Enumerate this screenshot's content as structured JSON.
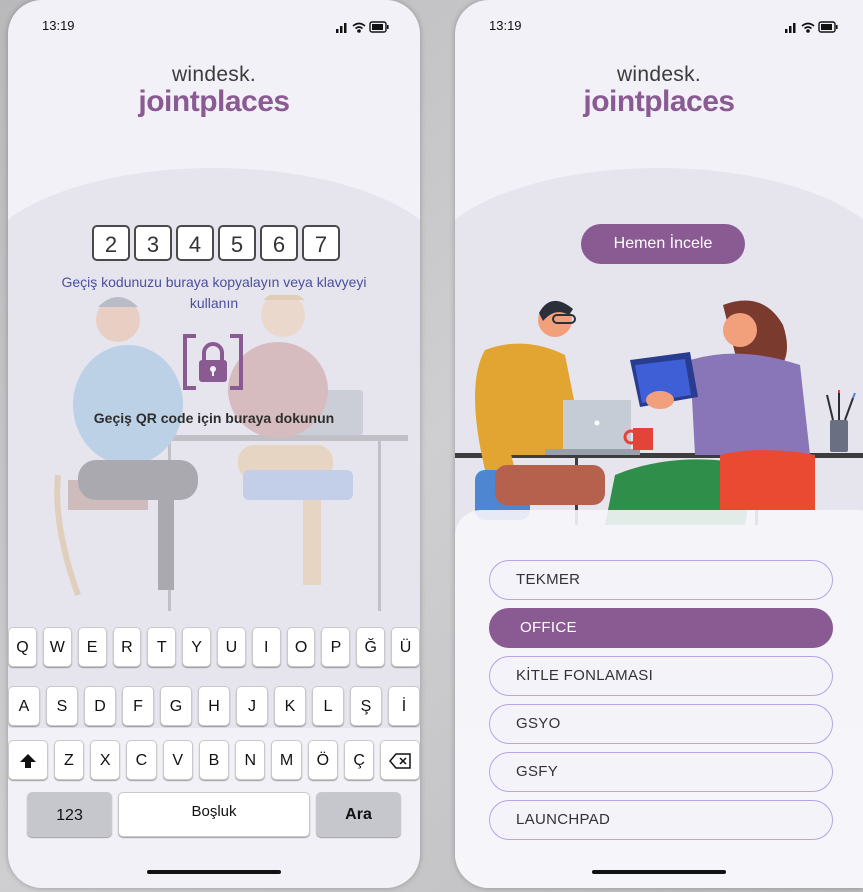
{
  "left": {
    "status": {
      "time": "13:19"
    },
    "logo": {
      "top": "windesk.",
      "main": "jointplaces"
    },
    "code_digits": [
      "2",
      "3",
      "4",
      "5",
      "6",
      "7"
    ],
    "instruction": "Geçiş kodunuzu buraya kopyalayın veya klavyeyi kullanın",
    "qr_text": "Geçiş QR code için buraya dokunun",
    "keyboard": {
      "row1": [
        "Q",
        "W",
        "E",
        "R",
        "T",
        "Y",
        "U",
        "I",
        "O",
        "P",
        "Ğ",
        "Ü"
      ],
      "row2": [
        "A",
        "S",
        "D",
        "F",
        "G",
        "H",
        "J",
        "K",
        "L",
        "Ş",
        "İ"
      ],
      "row3": [
        "Z",
        "X",
        "C",
        "V",
        "B",
        "N",
        "M",
        "Ö",
        "Ç"
      ],
      "numbers_label": "123",
      "space_label": "Boşluk",
      "search_label": "Ara"
    }
  },
  "right": {
    "status": {
      "time": "13:19"
    },
    "logo": {
      "top": "windesk.",
      "main": "jointplaces"
    },
    "cta_label": "Hemen İncele",
    "options": [
      {
        "label": "TEKMER",
        "selected": false
      },
      {
        "label": "OFFICE",
        "selected": true
      },
      {
        "label": "KİTLE FONLAMASI",
        "selected": false
      },
      {
        "label": "GSYO",
        "selected": false
      },
      {
        "label": "GSFY",
        "selected": false
      },
      {
        "label": "LAUNCHPAD",
        "selected": false
      }
    ]
  },
  "colors": {
    "brand": "#8a5a93",
    "instruction": "#4b4f9a",
    "option_border": "#b6a4e6"
  }
}
